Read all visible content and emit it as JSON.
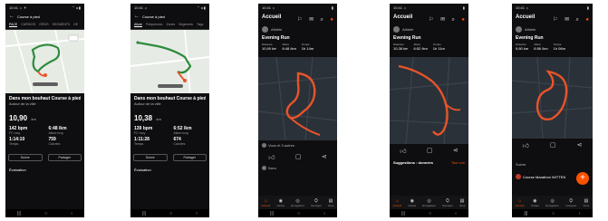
{
  "phones": {
    "p1": {
      "status_time": "10:41 ☼ ☀",
      "status_icons": "⌃ ◂ ▮",
      "header_title": "Course à pied",
      "tabs": [
        "PACE",
        "CARDIOS",
        "ORGS",
        "SEGMENTS",
        "DE"
      ],
      "activity_title": "Dans mon bouhaut Course à pied",
      "activity_sub": "Autour de la ville",
      "distance": "10,90",
      "distance_unit": "km",
      "stats": [
        {
          "value": "142 bpm",
          "label": "FC moy"
        },
        {
          "value": "6:48 /km",
          "label": "Allure moy"
        },
        {
          "value": "1:14:10",
          "label": "Temps"
        },
        {
          "value": "759",
          "label": "Calories"
        }
      ],
      "btn_left": "Suivre",
      "btn_right": "Partager",
      "section": "Évaluation"
    },
    "p2": {
      "status_time": "10:41 ☼",
      "status_icons": "⌃ ◂ ▮",
      "header_title": "Course à pied",
      "tabs": [
        "Allure",
        "Fréquences",
        "Zones",
        "Segments",
        "Tags"
      ],
      "activity_title": "Dans mon bouhaut Course à pied",
      "activity_sub": "Autour de la ville",
      "distance": "10,38",
      "distance_unit": "km",
      "stats": [
        {
          "value": "139 bpm",
          "label": "FC moy"
        },
        {
          "value": "6:52 /km",
          "label": "Allure moy"
        },
        {
          "value": "1:11:28",
          "label": "Temps"
        },
        {
          "value": "674",
          "label": "Calories"
        }
      ],
      "btn_left": "Suivre",
      "btn_right": "Partager",
      "section": "Évaluation"
    },
    "p3": {
      "status_time": "10:41 ☼",
      "status_icons": "▮",
      "header_title": "Accueil",
      "user": "Athlete",
      "activity_title": "Evening Run",
      "stats_labels": [
        "Distance",
        "Allure",
        "Temps"
      ],
      "stats_values": [
        "10,90 km",
        "6:48 /km",
        "1h 14m"
      ],
      "likes": "Vous et 3 autres",
      "tabbar": [
        "Accueil",
        "Cartes",
        "Enregistrer",
        "Groupes",
        "Vous"
      ],
      "comment": "Nora"
    },
    "p4": {
      "status_time": "10:41 ☼",
      "status_icons": "▮",
      "header_title": "Accueil",
      "user": "Athlete",
      "activity_title": "Evening Run",
      "stats_labels": [
        "Distance",
        "Allure",
        "Temps"
      ],
      "stats_values": [
        "10,38 km",
        "6:52 /km",
        "1h 11m"
      ],
      "suggestion": "Suggestions : données",
      "suggestion_link": "Tout voir",
      "tabbar": [
        "Accueil",
        "Cartes",
        "Enregistrer",
        "Groupes",
        "Vous"
      ]
    },
    "p5": {
      "status_time": "10:41 ☼",
      "status_icons": "▮",
      "header_title": "Accueil",
      "user": "Athlete",
      "activity_title": "Evening Run",
      "stats_labels": [
        "Distance",
        "Allure",
        "Temps"
      ],
      "stats_values": [
        "9,60 km",
        "6:56 /km",
        "1h 06m"
      ],
      "club_text": "Suivre",
      "club_name": "Course Marathon WITTEN",
      "tabbar": [
        "Accueil",
        "Cartes",
        "Enregistrer",
        "Groupes",
        "Vous"
      ]
    }
  },
  "colors": {
    "accent": "#fc5200",
    "route_green": "#2e8b3d",
    "route_orange": "#e8542a"
  }
}
